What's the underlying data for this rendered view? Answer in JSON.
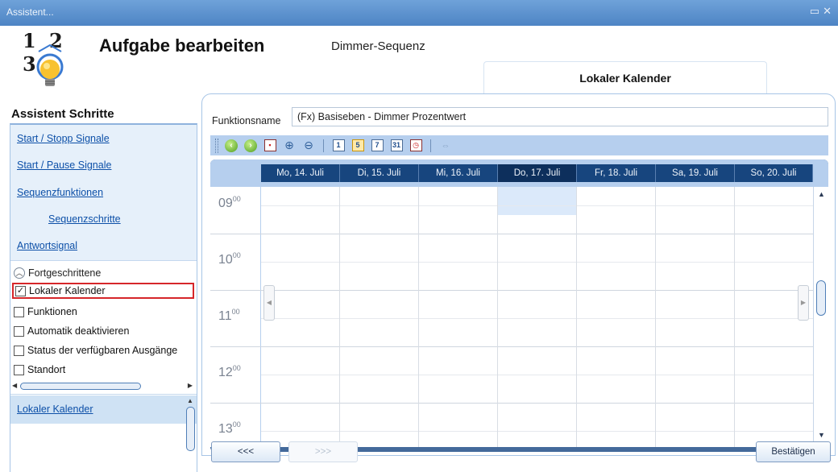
{
  "window": {
    "title": "Assistent..."
  },
  "header": {
    "logo_digits": "1 2 3",
    "title": "Aufgabe bearbeiten",
    "subtitle": "Dimmer-Sequenz",
    "tab_label": "Lokaler Kalender"
  },
  "sidebar": {
    "title": "Assistent Schritte",
    "steps": [
      {
        "label": "Start / Stopp Signale"
      },
      {
        "label": "Start / Pause Signale"
      },
      {
        "label": "Sequenzfunktionen"
      },
      {
        "label": "Sequenzschritte"
      },
      {
        "label": "Antwortsignal"
      }
    ],
    "advanced": {
      "label": "Fortgeschrittene",
      "items": [
        {
          "label": "Lokaler Kalender",
          "checked": true
        },
        {
          "label": "Funktionen",
          "checked": false
        },
        {
          "label": "Automatik deaktivieren",
          "checked": false
        },
        {
          "label": "Status der verfügbaren Ausgänge",
          "checked": false
        },
        {
          "label": "Standort",
          "checked": false
        }
      ]
    },
    "current_link": "Lokaler Kalender"
  },
  "function": {
    "label": "Funktionsname",
    "value": "(Fx) Basiseben - Dimmer Prozentwert"
  },
  "toolbar": {
    "buttons": [
      "back-icon",
      "forward-icon",
      "today-icon",
      "zoom-in-icon",
      "zoom-out-icon",
      "day-view-icon",
      "work-week-view-icon",
      "week-view-icon",
      "month-view-icon",
      "timeline-view-icon",
      "expand-icon"
    ],
    "view_labels": {
      "day": "1",
      "work_week": "5",
      "week": "7",
      "month": "31"
    }
  },
  "calendar": {
    "days": [
      "Mo, 14. Juli",
      "Di, 15. Juli",
      "Mi, 16. Juli",
      "Do, 17. Juli",
      "Fr, 18. Juli",
      "Sa, 19. Juli",
      "So, 20. Juli"
    ],
    "today": "Do, 17. Juli",
    "hours": [
      "09",
      "10",
      "11",
      "12",
      "13"
    ],
    "minutes": "00"
  },
  "buttons": {
    "back": "<<<",
    "next": ">>>",
    "confirm": "Bestätigen"
  },
  "colors": {
    "titlebar": "#5a8fcf",
    "toolbar": "#b6cfee",
    "day_header": "#17457e",
    "link": "#0d50a8",
    "highlight_border": "#d6262a"
  }
}
